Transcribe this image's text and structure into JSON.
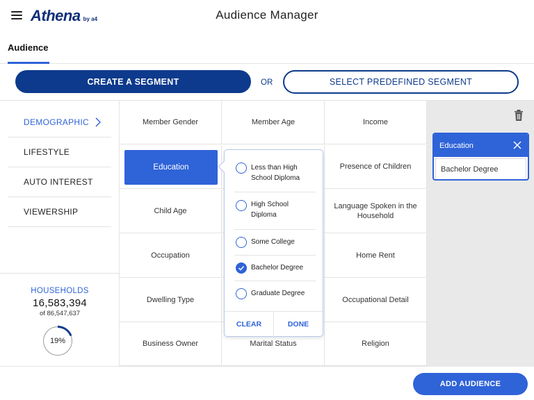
{
  "header": {
    "menu_icon": "hamburger-icon",
    "logo_text": "Athena",
    "logo_sub": "by a4",
    "title": "Audience Manager"
  },
  "tabs": [
    {
      "label": "Audience",
      "active": true
    }
  ],
  "segment_actions": {
    "create_label": "CREATE A SEGMENT",
    "or_label": "OR",
    "select_label": "SELECT PREDEFINED SEGMENT"
  },
  "sidebar": {
    "items": [
      {
        "label": "DEMOGRAPHIC",
        "active": true,
        "icon": "chevron-right-icon"
      },
      {
        "label": "LIFESTYLE",
        "active": false
      },
      {
        "label": "AUTO INTEREST",
        "active": false
      },
      {
        "label": "VIEWERSHIP",
        "active": false
      }
    ]
  },
  "households": {
    "label": "HOUSEHOLDS",
    "count": "16,583,394",
    "of_text": "of 86,547,637",
    "percent_label": "19%",
    "percent_value": 0.19
  },
  "grid": {
    "cells": [
      "Member Gender",
      "Member Age",
      "Income",
      "Education",
      "Marital Status",
      "Presence of Children",
      "Child Age",
      "",
      "Language Spoken in the Household",
      "Occupation",
      "",
      "Home Rent",
      "Dwelling Type",
      "",
      "Occupational Detail",
      "Business Owner",
      "Marital Status",
      "Religion"
    ],
    "selected": "Education"
  },
  "popover": {
    "options": [
      {
        "label": "Less than High School Diploma",
        "checked": false
      },
      {
        "label": "High School Diploma",
        "checked": false
      },
      {
        "label": "Some College",
        "checked": false
      },
      {
        "label": "Bachelor Degree",
        "checked": true
      },
      {
        "label": "Graduate Degree",
        "checked": false
      }
    ],
    "clear_label": "CLEAR",
    "done_label": "DONE"
  },
  "selection_panel": {
    "trash_icon": "trash-icon",
    "card": {
      "title": "Education",
      "value": "Bachelor Degree",
      "close_icon": "close-icon"
    }
  },
  "footer": {
    "add_label": "ADD AUDIENCE"
  },
  "colors": {
    "primary_dark": "#0d3a8c",
    "primary": "#2f63d8",
    "panel_gray": "#e9e9e9"
  }
}
